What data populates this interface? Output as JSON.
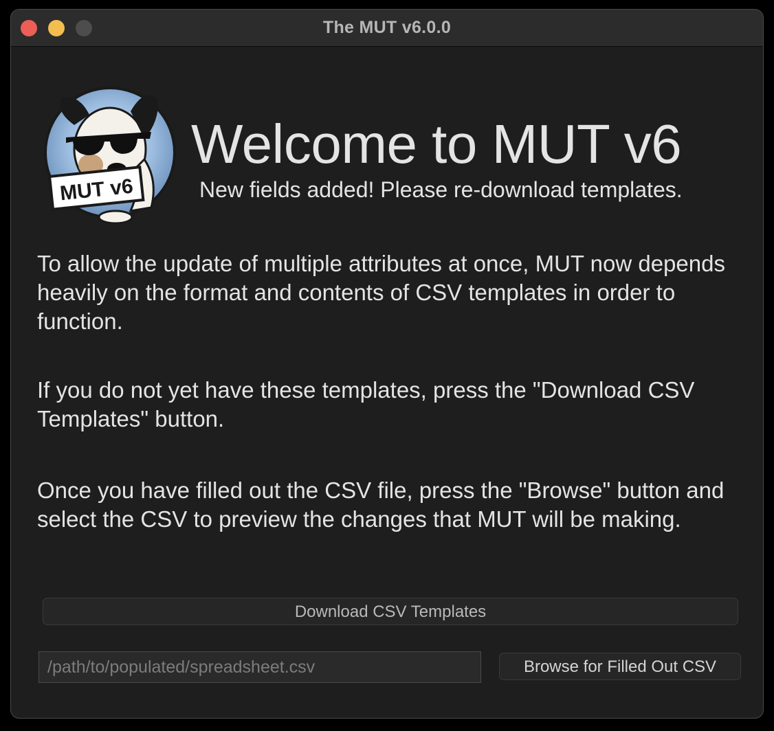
{
  "window": {
    "title": "The MUT v6.0.0"
  },
  "logo": {
    "badge_text": "MUT v6",
    "icon": "dog-with-sunglasses-logo"
  },
  "header": {
    "title": "Welcome to MUT v6",
    "subtitle": "New fields added! Please re-download templates."
  },
  "body": {
    "paragraphs": [
      "To allow the update of multiple attributes at once, MUT now depends heavily on the format and contents of CSV templates in order to function.",
      "If you do not yet have these templates, press the \"Download CSV Templates\" button.",
      "Once you have filled out the CSV file, press the \"Browse\" button and select the CSV to preview the changes that MUT will be making."
    ]
  },
  "actions": {
    "download_label": "Download CSV Templates",
    "path_placeholder": "/path/to/populated/spreadsheet.csv",
    "path_value": "",
    "browse_label": "Browse for Filled Out CSV"
  },
  "colors": {
    "close": "#ec5f57",
    "minimize": "#f4bd4f",
    "zoom_disabled": "#4d4d4d",
    "window_bg": "#1e1e1e",
    "logo_circle": "#8fb3d9"
  }
}
